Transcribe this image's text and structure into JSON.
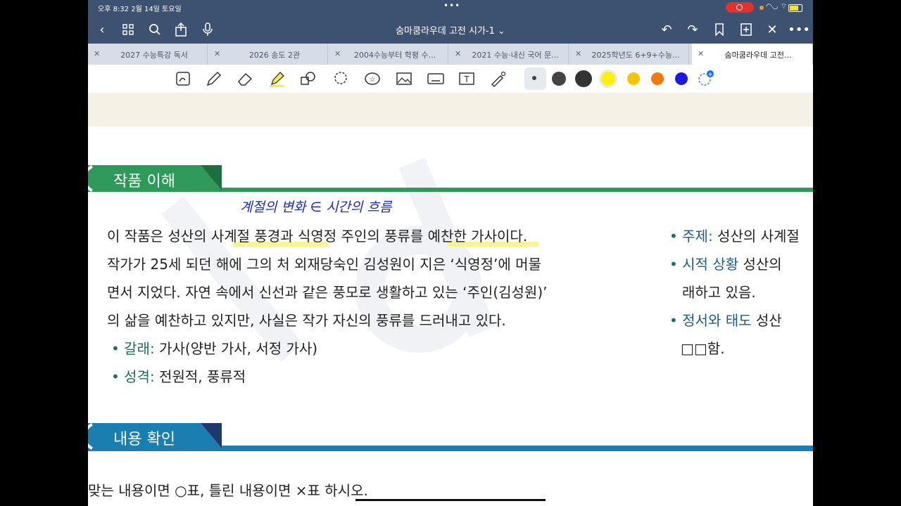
{
  "status_bar": {
    "time": "오후 8:32   2월 14일 토요일"
  },
  "doc": {
    "title": "숨마쿰라우데 고전 시가-1 ⌄"
  },
  "tabs": [
    {
      "label": "2027 수능특강 독서"
    },
    {
      "label": "2026 송도 2관"
    },
    {
      "label": "2004수능부터 학평 수..."
    },
    {
      "label": "2021 수능·내신 국어 문..."
    },
    {
      "label": "2025학년도 6+9+수능..."
    },
    {
      "label": "숨마쿰라우데 고전..."
    }
  ],
  "colors": {
    "toolbar": "#3d5270",
    "section1": "#2e9a5a",
    "section2": "#1a7fb0",
    "highlight": "#f6f27a",
    "ink": "#1b2db5"
  },
  "palette": [
    "#444444",
    "#333333",
    "#fff200",
    "#f5c400",
    "#f07a10",
    "#1a1adc"
  ],
  "section1": {
    "heading": "작품 이해",
    "handwriting": "계절의 변화 ∈ 시간의 흐름",
    "para": [
      "이 작품은 성산의 사계절 풍경과 식영정 주인의 풍류를 예찬한 가사이다.",
      "작가가 25세 되던 해에 그의 처 외재당숙인 김성원이 지은 ‘식영정’에 머물",
      "면서 지었다. 자연 속에서 신선과 같은 풍모로 생활하고 있는 ‘주인(김성원)’",
      "의 삶을 예찬하고 있지만, 사실은 작가 자신의 풍류를 드러내고 있다."
    ],
    "genre_label": "갈래:",
    "genre_value": " 가사(양반 가사, 서정 가사)",
    "nature_label": "성격:",
    "nature_value": " 전원적, 풍류적",
    "right": [
      {
        "label": "주제:",
        "value": " 성산의 사계절"
      },
      {
        "label": "시적 상황",
        "value": "  성산의"
      },
      {
        "label": "",
        "value": "래하고 있음."
      },
      {
        "label": "정서와 태도",
        "value": "   성산"
      },
      {
        "label": "",
        "value": "□□함."
      }
    ]
  },
  "section2": {
    "heading": "내용 확인",
    "instruction": "맞는 내용이면 ○표, 틀린 내용이면 ×표 하시오."
  }
}
